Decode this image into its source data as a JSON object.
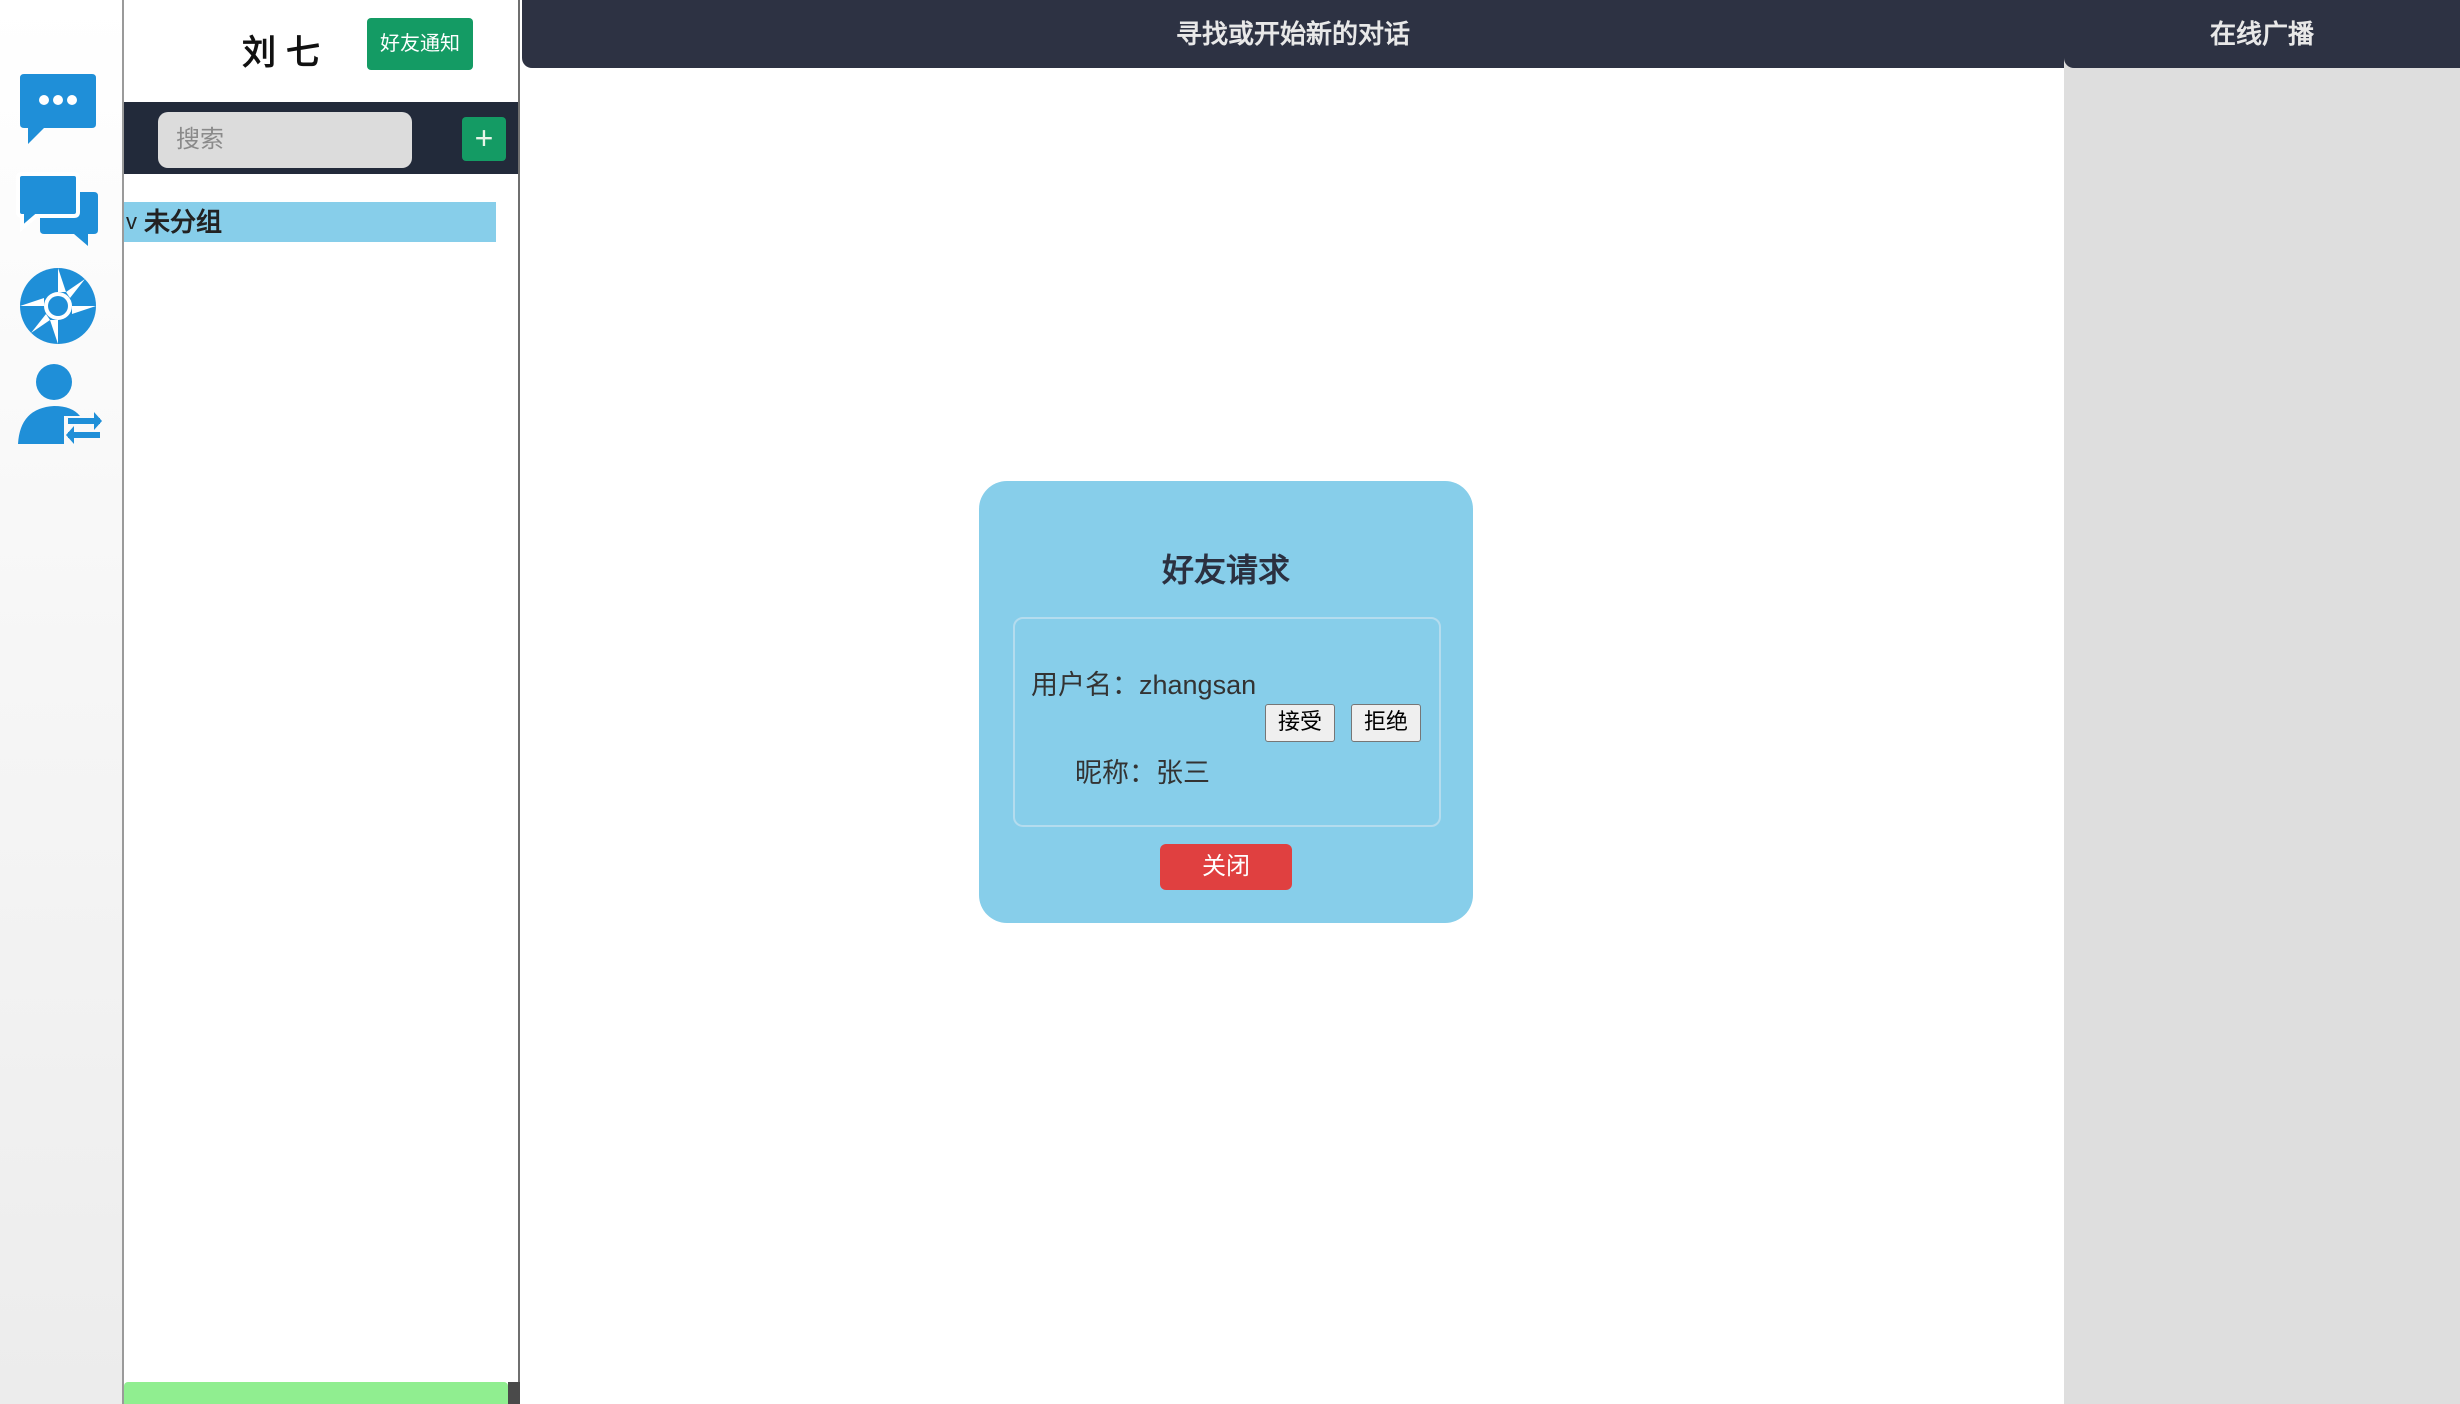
{
  "rail": {
    "icons": [
      "chat-bubble-icon",
      "conversations-icon",
      "shutter-icon",
      "user-switch-icon"
    ],
    "icon_color": "#1f8fd8"
  },
  "contacts": {
    "username": "刘七",
    "notify_label": "好友通知",
    "search_placeholder": "搜索",
    "add_label": "+",
    "group": {
      "chevron": "v",
      "label": "未分组"
    }
  },
  "main": {
    "header_title": "寻找或开始新的对话"
  },
  "broadcast": {
    "header_title": "在线广播"
  },
  "dialog": {
    "title": "好友请求",
    "request": {
      "username_text": "用户名：zhangsan",
      "nickname_text": "昵称：张三",
      "accept_label": "接受",
      "reject_label": "拒绝"
    },
    "close_label": "关闭"
  },
  "colors": {
    "header_bg": "#2d3243",
    "accent_green": "#149b64",
    "dialog_bg": "#87ceea",
    "close_red": "#e04040",
    "group_bg": "#87ceea",
    "bottom_bar": "#90ee90"
  }
}
